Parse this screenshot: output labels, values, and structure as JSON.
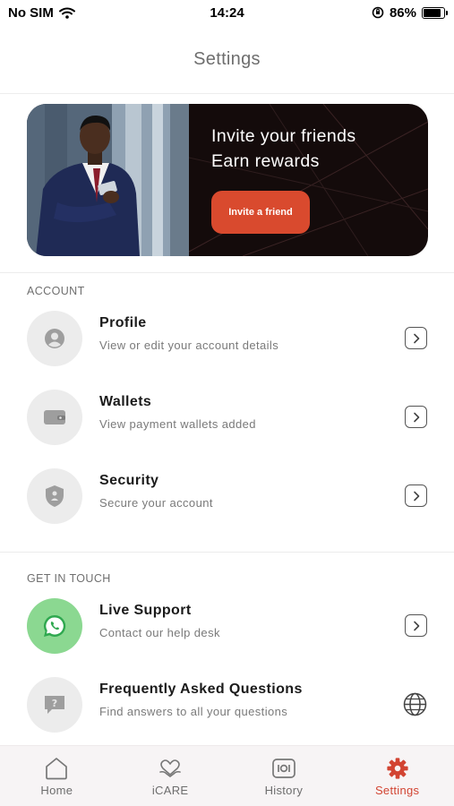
{
  "status_bar": {
    "carrier": "No SIM",
    "time": "14:24",
    "battery": "86%",
    "battery_level": 0.86
  },
  "header": {
    "title": "Settings"
  },
  "banner": {
    "line1": "Invite your friends",
    "line2": "Earn rewards",
    "button_label": "Invite a friend"
  },
  "account": {
    "section_title": "ACCOUNT",
    "items": [
      {
        "title": "Profile",
        "subtitle": "View or edit your account details",
        "icon": "person-icon",
        "action_icon": "chevron-right-icon"
      },
      {
        "title": "Wallets",
        "subtitle": "View payment wallets added",
        "icon": "wallet-icon",
        "action_icon": "chevron-right-icon"
      },
      {
        "title": "Security",
        "subtitle": "Secure your account",
        "icon": "shield-icon",
        "action_icon": "chevron-right-icon"
      }
    ]
  },
  "contact": {
    "section_title": "GET IN TOUCH",
    "items": [
      {
        "title": "Live Support",
        "subtitle": "Contact our help desk",
        "icon": "whatsapp-icon",
        "action_icon": "chevron-right-icon"
      },
      {
        "title": "Frequently Asked Questions",
        "subtitle": "Find answers to all your questions",
        "icon": "question-bubble-icon",
        "action_icon": "globe-icon"
      }
    ]
  },
  "bottom_nav": {
    "items": [
      {
        "label": "Home",
        "icon": "home-icon",
        "active": false
      },
      {
        "label": "iCARE",
        "icon": "heart-hands-icon",
        "active": false
      },
      {
        "label": "History",
        "icon": "history-icon",
        "active": false
      },
      {
        "label": "Settings",
        "icon": "gear-icon",
        "active": true
      }
    ]
  },
  "colors": {
    "accent": "#d24432",
    "invite_button": "#d94a2e",
    "banner_bg": "#140b0b",
    "whatsapp_circle": "#8bd891"
  }
}
